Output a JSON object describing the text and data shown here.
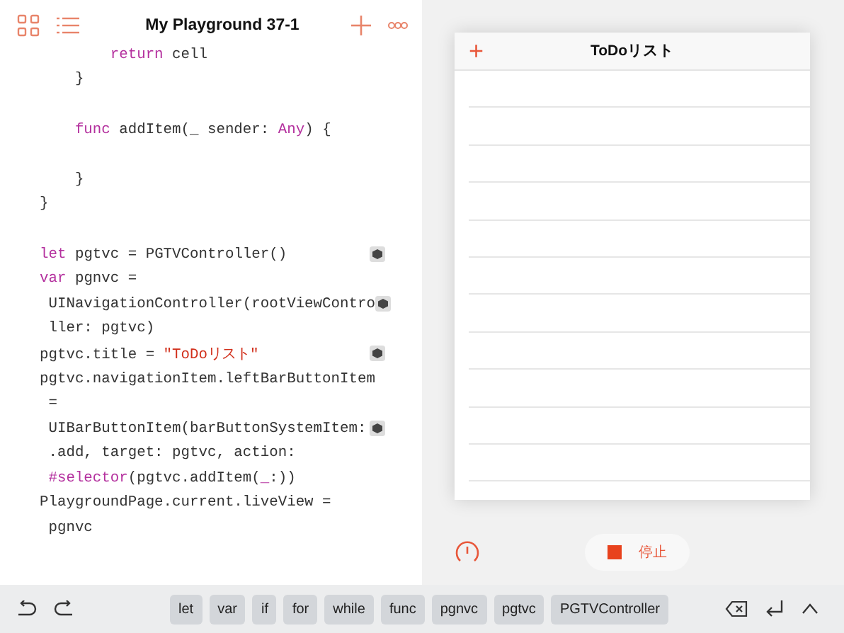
{
  "editor": {
    "title": "My Playground 37-1",
    "lines": [
      {
        "tokens": [
          {
            "kind": "keyword",
            "text": "        return"
          },
          {
            "kind": "plain",
            "text": " cell"
          }
        ],
        "result": false
      },
      {
        "tokens": [
          {
            "kind": "plain",
            "text": "    }"
          }
        ],
        "result": false
      },
      {
        "gap_before": true,
        "tokens": [
          {
            "kind": "keyword",
            "text": "    func"
          },
          {
            "kind": "plain",
            "text": " addItem(_ sender: "
          },
          {
            "kind": "keyword",
            "text": "Any"
          },
          {
            "kind": "plain",
            "text": ") {"
          }
        ],
        "result": false
      },
      {
        "gap_before": true,
        "tokens": [
          {
            "kind": "plain",
            "text": "    }"
          }
        ],
        "result": false
      },
      {
        "tokens": [
          {
            "kind": "plain",
            "text": "}"
          }
        ],
        "result": false
      },
      {
        "gap_before": true,
        "tokens": [
          {
            "kind": "keyword",
            "text": "let"
          },
          {
            "kind": "plain",
            "text": " pgtvc = PGTVController()"
          }
        ],
        "result": true
      },
      {
        "tokens": [
          {
            "kind": "keyword",
            "text": "var"
          },
          {
            "kind": "plain",
            "text": " pgnvc ="
          }
        ],
        "result": false
      },
      {
        "tokens": [
          {
            "kind": "plain",
            "text": " UINavigationController(rootViewContro"
          }
        ],
        "result": true
      },
      {
        "tokens": [
          {
            "kind": "plain",
            "text": " ller: pgtvc)"
          }
        ],
        "result": false
      },
      {
        "tokens": [
          {
            "kind": "plain",
            "text": "pgtvc.title = "
          },
          {
            "kind": "string",
            "text": "\"ToDoリスト\""
          }
        ],
        "result": true
      },
      {
        "tokens": [
          {
            "kind": "plain",
            "text": "pgtvc.navigationItem.leftBarButtonItem"
          }
        ],
        "result": false
      },
      {
        "tokens": [
          {
            "kind": "plain",
            "text": " ="
          }
        ],
        "result": false
      },
      {
        "tokens": [
          {
            "kind": "plain",
            "text": " UIBarButtonItem(barButtonSystemItem:"
          }
        ],
        "result": true
      },
      {
        "tokens": [
          {
            "kind": "plain",
            "text": " .add, target: pgtvc, action:"
          }
        ],
        "result": false
      },
      {
        "tokens": [
          {
            "kind": "keyword",
            "text": " #selector"
          },
          {
            "kind": "plain",
            "text": "(pgtvc.addItem("
          },
          {
            "kind": "keyword",
            "text": "_"
          },
          {
            "kind": "plain",
            "text": ":))"
          }
        ],
        "result": false
      },
      {
        "tokens": [
          {
            "kind": "plain",
            "text": "PlaygroundPage.current.liveView ="
          }
        ],
        "result": false
      },
      {
        "tokens": [
          {
            "kind": "plain",
            "text": " pgnvc"
          }
        ],
        "result": false
      }
    ]
  },
  "live_view": {
    "title": "ToDoリスト",
    "plus": "+",
    "stop_label": "停止"
  },
  "shortcuts": [
    "let",
    "var",
    "if",
    "for",
    "while",
    "func",
    "pgnvc",
    "pgtvc",
    "PGTVController"
  ]
}
